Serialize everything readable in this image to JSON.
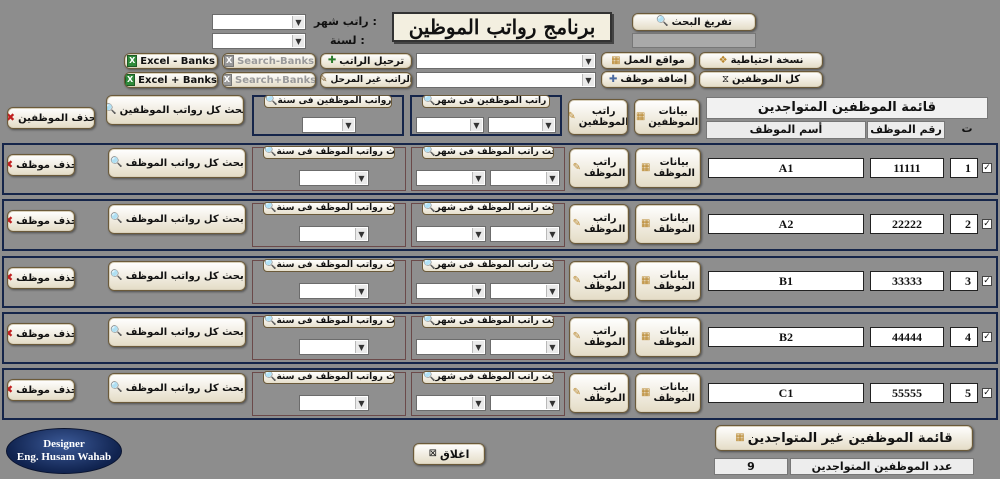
{
  "title": "برنامج رواتب الموظين",
  "search_clear": "تفريغ البحث",
  "month_label": "راتب شهر :",
  "year_label": "لسنة :",
  "toolbar": {
    "excel_banks_minus": "Excel - Banks",
    "search_banks_minus": "Search-Banks",
    "transfer_salary": "ترحيل الراتب",
    "work_sites": "مواقع العمل",
    "backup": "نسخة احتياطية",
    "excel_banks_plus": "Excel + Banks",
    "search_banks_plus": "Search+Banks",
    "salary_non_present": "الراتب غير المرحل",
    "add_employee": "إضافة موظف",
    "all_employees": "كل الموظفين"
  },
  "top": {
    "delete_employee": "حذف الموظفين",
    "search_all": "بحث كل رواتب الموظفين",
    "search_year": "بحث رواتب الموظفين فى سنة",
    "search_month": "بحث راتب الموظفين فى شهر",
    "salary_line1": "راتب",
    "salary_line2": "الموظفين",
    "data_line1": "بيانات",
    "data_line2": "الموظفين"
  },
  "list_header": {
    "title": "قائمة الموظفين المتواجدين",
    "col_num": "ت",
    "col_id": "رقم الموظف",
    "col_name": "أسم الموظف"
  },
  "row_labels": {
    "delete": "حذف موظف",
    "search_all": "بحث كل رواتب الموظف",
    "search_year": "بحث رواتب الموظف فى سنة",
    "search_month": "بحث راتب الموظف فى شهر",
    "salary_line1": "راتب",
    "salary_line2": "الموظف",
    "data_line1": "بيانات",
    "data_line2": "الموظف"
  },
  "employees": [
    {
      "num": "1",
      "id": "11111",
      "name": "A1"
    },
    {
      "num": "2",
      "id": "22222",
      "name": "A2"
    },
    {
      "num": "3",
      "id": "33333",
      "name": "B1"
    },
    {
      "num": "4",
      "id": "44444",
      "name": "B2"
    },
    {
      "num": "5",
      "id": "55555",
      "name": "C1"
    }
  ],
  "check_mark": "✓",
  "designer_line1": "Designer",
  "designer_line2": "Eng. Husam Wahab",
  "close": "اغلاق",
  "non_present_list": "قائمة الموظفين غير المتواجدين",
  "present_count_label": "عدد الموظفين المتواجدين",
  "present_count": "9"
}
